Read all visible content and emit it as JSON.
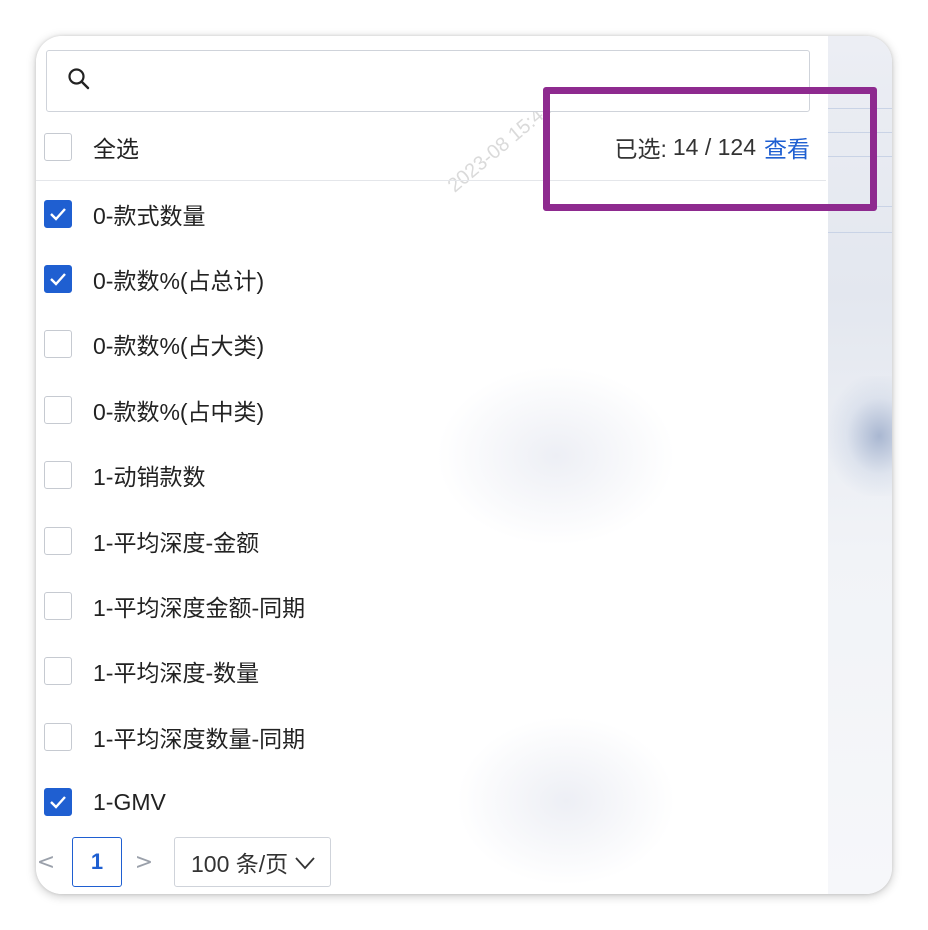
{
  "search": {
    "placeholder": "",
    "value": ""
  },
  "header": {
    "select_all_label": "全选",
    "selected_prefix": "已选:",
    "selected_count": "14 / 124",
    "view_link": "查看"
  },
  "items": [
    {
      "label": "0-款式数量",
      "checked": true
    },
    {
      "label": "0-款数%(占总计)",
      "checked": true
    },
    {
      "label": "0-款数%(占大类)",
      "checked": false
    },
    {
      "label": "0-款数%(占中类)",
      "checked": false
    },
    {
      "label": "1-动销款数",
      "checked": false
    },
    {
      "label": "1-平均深度-金额",
      "checked": false
    },
    {
      "label": "1-平均深度金额-同期",
      "checked": false
    },
    {
      "label": "1-平均深度-数量",
      "checked": false
    },
    {
      "label": "1-平均深度数量-同期",
      "checked": false
    },
    {
      "label": "1-GMV",
      "checked": true
    }
  ],
  "pagination": {
    "prev": "<",
    "current_page": "1",
    "next": ">",
    "page_size": "100 条/页"
  },
  "colors": {
    "accent": "#1f5fd1",
    "highlight_box": "#8e2a8f"
  }
}
